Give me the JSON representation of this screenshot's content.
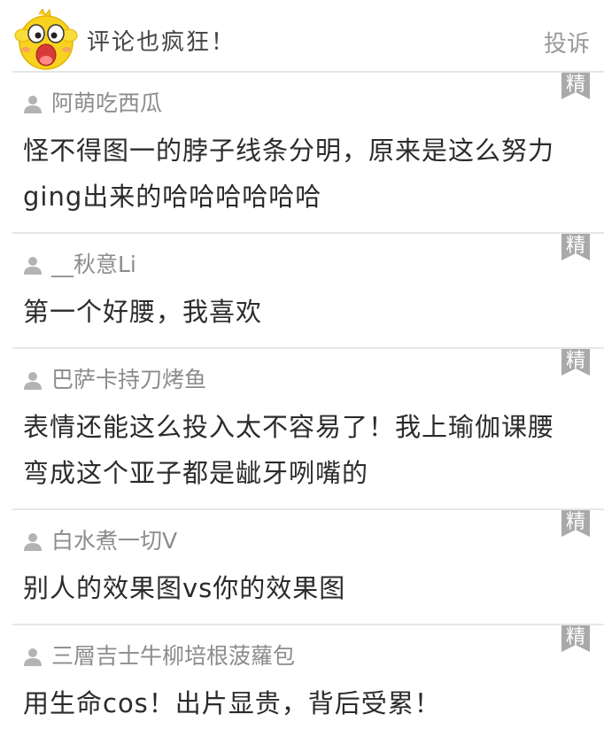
{
  "header": {
    "title": "评论也疯狂！",
    "report_label": "投诉",
    "mascot_icon": "yellow-chick-mascot-icon"
  },
  "badge_label": "精",
  "colors": {
    "badge": "#a9a9a9",
    "username": "#8c8c8c",
    "divider": "#e6e6e6",
    "mascot": "#f7d21e"
  },
  "comments": [
    {
      "username": "阿萌吃西瓜",
      "text": "怪不得图一的脖子线条分明，原来是这么努力ging出来的哈哈哈哈哈哈"
    },
    {
      "username": "__秋意Li",
      "text": "第一个好腰，我喜欢"
    },
    {
      "username": "巴萨卡持刀烤鱼",
      "text": "表情还能这么投入太不容易了！我上瑜伽课腰弯成这个亚子都是龇牙咧嘴的"
    },
    {
      "username": "白水煮一切V",
      "text": "别人的效果图vs你的效果图"
    },
    {
      "username": "三層吉士牛柳培根菠蘿包",
      "text": "用生命cos！出片显贵，背后受累！"
    }
  ]
}
